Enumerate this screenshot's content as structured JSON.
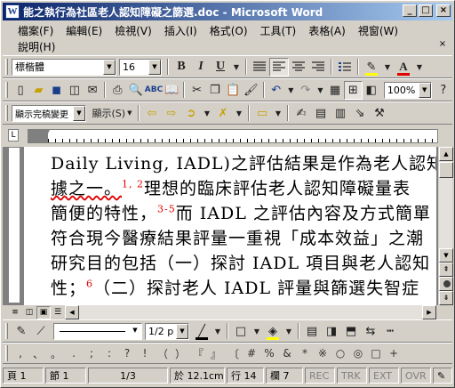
{
  "title": "能之執行為社區老人認知障礙之篩選.doc - Microsoft Word",
  "window_buttons": {
    "minimize": "_",
    "maximize": "□",
    "close": "×"
  },
  "menu": [
    "檔案(F)",
    "編輯(E)",
    "檢視(V)",
    "插入(I)",
    "格式(O)",
    "工具(T)",
    "表格(A)",
    "視窗(W)",
    "說明(H)"
  ],
  "doc_close": "×",
  "formatting": {
    "font": "標楷體",
    "size": "16",
    "bold": "B",
    "italic": "I",
    "underline": "U",
    "font_color": "#e00000",
    "highlight_color": "#ffff00"
  },
  "standard": {
    "zoom": "100%"
  },
  "reviewing": {
    "display_mode": "顯示完稿變更",
    "display": "顯示(S)"
  },
  "document_lines": [
    {
      "text": "Daily Living, IADL)之評估結果是作為老人認知",
      "cite": "",
      "rest": ""
    },
    {
      "text": "據之一。",
      "cite": "1, 2",
      "rest": "理想的臨床評估老人認知障礙量表"
    },
    {
      "text": "簡便的特性，",
      "cite": "3-5",
      "rest": "而 IADL 之評估內容及方式簡單"
    },
    {
      "text": "符合現今醫療結果評量一重視「成本效益」之潮",
      "cite": "",
      "rest": ""
    },
    {
      "text": "研究目的包括（一）探討 IADL 項目與老人認知",
      "cite": "",
      "rest": ""
    },
    {
      "text": "性；",
      "cite": "6",
      "rest": "（二）探討老人 IADL 評量與篩選失智症"
    }
  ],
  "drawing": {
    "line_width": "1/2 p",
    "line_color": "#000000",
    "fill_color": "#ffff00"
  },
  "punctuation": [
    ",",
    "、",
    "。",
    ".",
    ";",
    ":",
    "?",
    "!",
    "…",
    "—",
    "（",
    "）",
    "《",
    "》",
    "『",
    "』",
    "〔",
    "〕",
    "#",
    "%",
    "&",
    "*",
    "※",
    "○",
    "◎",
    "□",
    "+"
  ],
  "status": {
    "page": "頁 1",
    "section": "節 1",
    "pages": "1/3",
    "at": "於 12.1cm",
    "line": "行 14",
    "col": "欄 7",
    "rec": "REC",
    "trk": "TRK",
    "ext": "EXT",
    "ovr": "OVR"
  }
}
